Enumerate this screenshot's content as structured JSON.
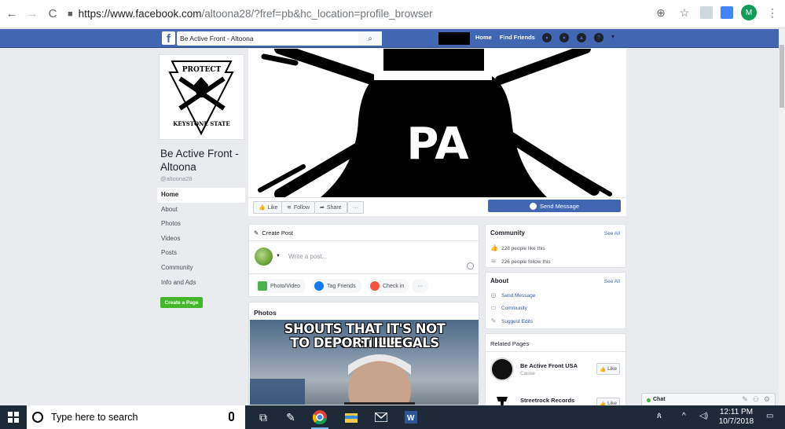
{
  "browser": {
    "url_host": "https://www.facebook.com",
    "url_path": "/altoona28/?fref=pb&hc_location=profile_browser",
    "avatar_letter": "M"
  },
  "fb": {
    "search_value": "Be Active Front - Altoona",
    "nav": [
      "Home",
      "Find Friends"
    ],
    "brand_color": "#4267b2"
  },
  "page": {
    "title": "Be Active Front - Altoona",
    "handle": "@altoona28",
    "profile_top_text": "PROTECT",
    "profile_bottom_text": "KEYSTONE STATE",
    "cover_text": "PA",
    "left_nav": [
      "Home",
      "About",
      "Photos",
      "Videos",
      "Posts",
      "Community",
      "Info and Ads"
    ],
    "create_page": "Create a Page"
  },
  "actions": {
    "like": "Like",
    "follow": "Follow",
    "share": "Share",
    "more": "···",
    "send_message": "Send Message"
  },
  "create_post": {
    "title": "Create Post",
    "placeholder": "Write a post...",
    "buttons": [
      "Photo/Video",
      "Tag Friends",
      "Check in",
      "···"
    ]
  },
  "photos": {
    "title": "Photos",
    "meme_line1": "SHOUTS THAT IT'S NOT POSSIBLE",
    "meme_line2": "TO DEPORT ILLEGALS"
  },
  "community": {
    "title": "Community",
    "see_all": "See All",
    "likes": "228 people like this",
    "follows": "226 people follow this"
  },
  "about": {
    "title": "About",
    "see_all": "See All",
    "rows": [
      "Send Message",
      "Community",
      "Suggest Edits"
    ]
  },
  "related": {
    "title": "Related Pages",
    "pages": [
      {
        "name": "Be Active Front USA",
        "sub": "Cause",
        "like": "Like"
      },
      {
        "name": "Streetrock Records",
        "sub": "",
        "like": "Like"
      }
    ]
  },
  "chat": {
    "label": "Chat"
  },
  "taskbar": {
    "search_placeholder": "Type here to search",
    "time": "12:11 PM",
    "date": "10/7/2018"
  }
}
